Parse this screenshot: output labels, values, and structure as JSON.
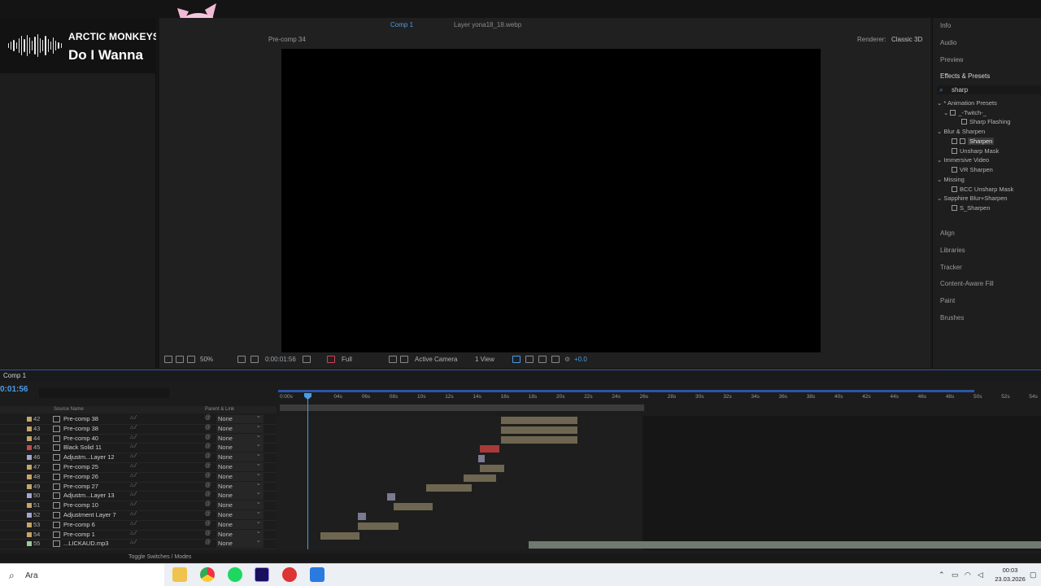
{
  "now_playing": {
    "artist": "ARCTIC MONKEYS",
    "track": "Do I Wanna"
  },
  "viewer": {
    "tab_comp": "Comp 1",
    "tab_layer": "Layer yona18_18.webp",
    "breadcrumb": "Pre-comp 34",
    "renderer_label": "Renderer:",
    "renderer_value": "Classic 3D",
    "zoom": "50%",
    "timecode": "0:00:01:56",
    "resolution": "Full",
    "camera": "Active Camera",
    "view": "1 View",
    "exposure": "+0.0"
  },
  "right_panel": {
    "items_top": [
      "Info",
      "Audio",
      "Preview"
    ],
    "effects_title": "Effects & Presets",
    "search_value": "sharp",
    "tree": [
      "* Animation Presets",
      "_-Twitch-_",
      "Sharp Flashing",
      "Blur & Sharpen",
      "Sharpen",
      "Unsharp Mask",
      "Immersive Video",
      "VR Sharpen",
      "Missing",
      "BCC Unsharp Mask",
      "Sapphire Blur+Sharpen",
      "S_Sharpen"
    ],
    "items_bottom": [
      "Align",
      "Libraries",
      "Tracker",
      "Content-Aware Fill",
      "Paint",
      "Brushes"
    ]
  },
  "timeline": {
    "title": "Comp 1",
    "current_time": "0:01:56",
    "col_source": "Source Name",
    "col_parent": "Parent & Link",
    "ticks": [
      "0:00s",
      "04s",
      "06s",
      "08s",
      "10s",
      "12s",
      "14s",
      "16s",
      "18s",
      "20s",
      "22s",
      "24s",
      "26s",
      "28s",
      "30s",
      "32s",
      "34s",
      "36s",
      "38s",
      "40s",
      "42s",
      "44s",
      "46s",
      "48s",
      "50s",
      "52s",
      "54s"
    ],
    "toggle_label": "Toggle Switches / Modes",
    "layers": [
      {
        "num": "42",
        "name": "Pre-comp 38",
        "parent": "None",
        "color": "#c4a56c"
      },
      {
        "num": "43",
        "name": "Pre-comp 38",
        "parent": "None",
        "color": "#c4a56c"
      },
      {
        "num": "44",
        "name": "Pre-comp 40",
        "parent": "None",
        "color": "#c4a56c"
      },
      {
        "num": "45",
        "name": "Black Solid 11",
        "parent": "None",
        "color": "#c24b4b"
      },
      {
        "num": "46",
        "name": "Adjustm...Layer 12",
        "parent": "None",
        "color": "#a4a4d6"
      },
      {
        "num": "47",
        "name": "Pre-comp 25",
        "parent": "None",
        "color": "#c4a56c"
      },
      {
        "num": "48",
        "name": "Pre-comp 26",
        "parent": "None",
        "color": "#c4a56c"
      },
      {
        "num": "49",
        "name": "Pre-comp 27",
        "parent": "None",
        "color": "#c4a56c"
      },
      {
        "num": "50",
        "name": "Adjustm...Layer 13",
        "parent": "None",
        "color": "#a4a4d6"
      },
      {
        "num": "51",
        "name": "Pre-comp 10",
        "parent": "None",
        "color": "#c4a56c"
      },
      {
        "num": "52",
        "name": "Adjustment Layer 7",
        "parent": "None",
        "color": "#a4a4d6"
      },
      {
        "num": "53",
        "name": "Pre-comp 6",
        "parent": "None",
        "color": "#c4a56c"
      },
      {
        "num": "54",
        "name": "Pre-comp 1",
        "parent": "None",
        "color": "#c4a56c"
      },
      {
        "num": "55",
        "name": "...LICKAUD.mp3",
        "parent": "None",
        "color": "#9ec9a0"
      }
    ]
  },
  "taskbar": {
    "search_placeholder": "Ara",
    "time": "00:03",
    "date": "23.03.2026"
  }
}
